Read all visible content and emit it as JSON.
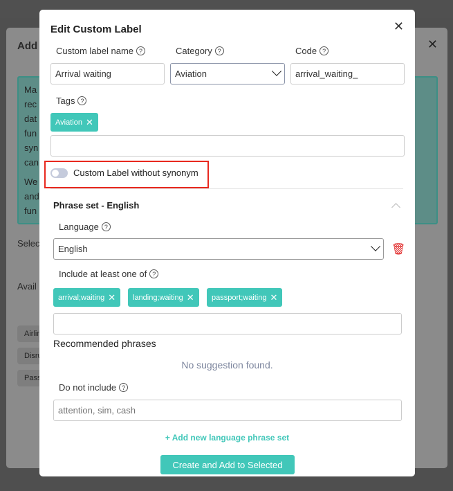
{
  "background": {
    "title_fragment": "Add",
    "text_fragments": [
      "Ma",
      "rec",
      "dat",
      "fun",
      "syn",
      "can",
      "We",
      "and",
      "fun"
    ],
    "select_fragment": "Selec",
    "available_fragment": "Avail",
    "chips": [
      "Airlin",
      "Disru",
      "Pass"
    ]
  },
  "modal": {
    "title": "Edit Custom Label",
    "fields": {
      "name_label": "Custom label name",
      "name_value": "Arrival waiting",
      "category_label": "Category",
      "category_value": "Aviation",
      "code_label": "Code",
      "code_value": "arrival_waiting_"
    },
    "tags_label": "Tags",
    "tags": [
      "Aviation"
    ],
    "toggle_label": "Custom Label without synonym",
    "toggle_on": false,
    "phrase_set": {
      "title": "Phrase set - English",
      "language_label": "Language",
      "language_value": "English",
      "include_label": "Include at least one of",
      "include_tags": [
        "arrival;waiting",
        "landing;waiting",
        "passport;waiting"
      ],
      "recommended_label": "Recommended phrases",
      "no_suggestion": "No suggestion found.",
      "exclude_label": "Do not include",
      "exclude_placeholder": "attention, sim, cash"
    },
    "add_language": "+ Add new language phrase set",
    "submit": "Create and Add to Selected"
  },
  "colors": {
    "accent": "#41c7b9",
    "highlight": "#e8281e",
    "delete": "#e02020"
  }
}
